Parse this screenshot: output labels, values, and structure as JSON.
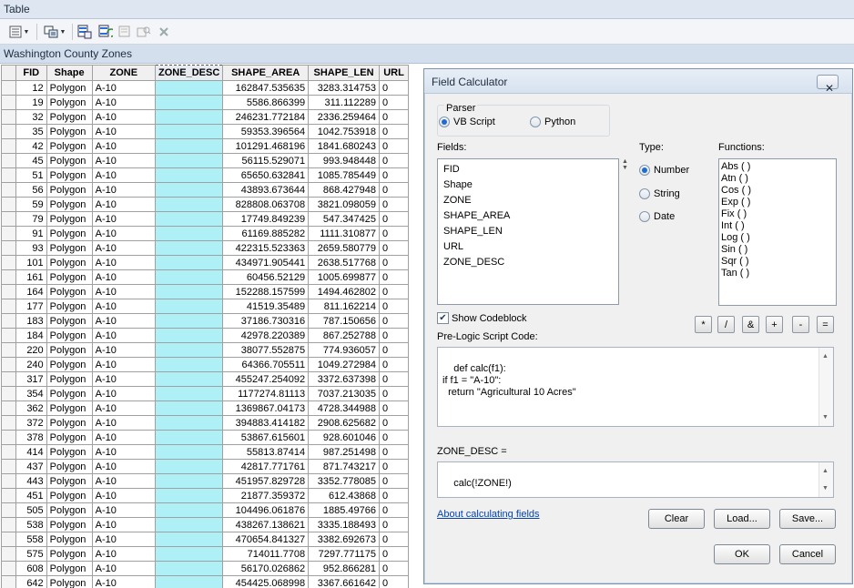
{
  "window": {
    "title": "Table"
  },
  "table_title": "Washington County Zones",
  "columns": [
    "FID",
    "Shape",
    "ZONE",
    "ZONE_DESC",
    "SHAPE_AREA",
    "SHAPE_LEN",
    "URL"
  ],
  "rows": [
    [
      "12",
      "Polygon",
      "A-10",
      "",
      "162847.535635",
      "3283.314753",
      "0"
    ],
    [
      "19",
      "Polygon",
      "A-10",
      "",
      "5586.866399",
      "311.112289",
      "0"
    ],
    [
      "32",
      "Polygon",
      "A-10",
      "",
      "246231.772184",
      "2336.259464",
      "0"
    ],
    [
      "35",
      "Polygon",
      "A-10",
      "",
      "59353.396564",
      "1042.753918",
      "0"
    ],
    [
      "42",
      "Polygon",
      "A-10",
      "",
      "101291.468196",
      "1841.680243",
      "0"
    ],
    [
      "45",
      "Polygon",
      "A-10",
      "",
      "56115.529071",
      "993.948448",
      "0"
    ],
    [
      "51",
      "Polygon",
      "A-10",
      "",
      "65650.632841",
      "1085.785449",
      "0"
    ],
    [
      "56",
      "Polygon",
      "A-10",
      "",
      "43893.673644",
      "868.427948",
      "0"
    ],
    [
      "59",
      "Polygon",
      "A-10",
      "",
      "828808.063708",
      "3821.098059",
      "0"
    ],
    [
      "79",
      "Polygon",
      "A-10",
      "",
      "17749.849239",
      "547.347425",
      "0"
    ],
    [
      "91",
      "Polygon",
      "A-10",
      "",
      "61169.885282",
      "1111.310877",
      "0"
    ],
    [
      "93",
      "Polygon",
      "A-10",
      "",
      "422315.523363",
      "2659.580779",
      "0"
    ],
    [
      "101",
      "Polygon",
      "A-10",
      "",
      "434971.905441",
      "2638.517768",
      "0"
    ],
    [
      "161",
      "Polygon",
      "A-10",
      "",
      "60456.52129",
      "1005.699877",
      "0"
    ],
    [
      "164",
      "Polygon",
      "A-10",
      "",
      "152288.157599",
      "1494.462802",
      "0"
    ],
    [
      "177",
      "Polygon",
      "A-10",
      "",
      "41519.35489",
      "811.162214",
      "0"
    ],
    [
      "183",
      "Polygon",
      "A-10",
      "",
      "37186.730316",
      "787.150656",
      "0"
    ],
    [
      "184",
      "Polygon",
      "A-10",
      "",
      "42978.220389",
      "867.252788",
      "0"
    ],
    [
      "220",
      "Polygon",
      "A-10",
      "",
      "38077.552875",
      "774.936057",
      "0"
    ],
    [
      "240",
      "Polygon",
      "A-10",
      "",
      "64366.705511",
      "1049.272984",
      "0"
    ],
    [
      "317",
      "Polygon",
      "A-10",
      "",
      "455247.254092",
      "3372.637398",
      "0"
    ],
    [
      "354",
      "Polygon",
      "A-10",
      "",
      "1177274.81113",
      "7037.213035",
      "0"
    ],
    [
      "362",
      "Polygon",
      "A-10",
      "",
      "1369867.04173",
      "4728.344988",
      "0"
    ],
    [
      "372",
      "Polygon",
      "A-10",
      "",
      "394883.414182",
      "2908.625682",
      "0"
    ],
    [
      "378",
      "Polygon",
      "A-10",
      "",
      "53867.615601",
      "928.601046",
      "0"
    ],
    [
      "414",
      "Polygon",
      "A-10",
      "",
      "55813.87414",
      "987.251498",
      "0"
    ],
    [
      "437",
      "Polygon",
      "A-10",
      "",
      "42817.771761",
      "871.743217",
      "0"
    ],
    [
      "443",
      "Polygon",
      "A-10",
      "",
      "451957.829728",
      "3352.778085",
      "0"
    ],
    [
      "451",
      "Polygon",
      "A-10",
      "",
      "21877.359372",
      "612.43868",
      "0"
    ],
    [
      "505",
      "Polygon",
      "A-10",
      "",
      "104496.061876",
      "1885.49766",
      "0"
    ],
    [
      "538",
      "Polygon",
      "A-10",
      "",
      "438267.138621",
      "3335.188493",
      "0"
    ],
    [
      "558",
      "Polygon",
      "A-10",
      "",
      "470654.841327",
      "3382.692673",
      "0"
    ],
    [
      "575",
      "Polygon",
      "A-10",
      "",
      "714011.7708",
      "7297.771175",
      "0"
    ],
    [
      "608",
      "Polygon",
      "A-10",
      "",
      "56170.026862",
      "952.866281",
      "0"
    ],
    [
      "642",
      "Polygon",
      "A-10",
      "",
      "454425.068998",
      "3367.661642",
      "0"
    ]
  ],
  "dialog": {
    "title": "Field Calculator",
    "close_glyph": "✕",
    "parser_label": "Parser",
    "parser_options": [
      "VB Script",
      "Python"
    ],
    "parser_selected": "VB Script",
    "fields_label": "Fields:",
    "fields": [
      "FID",
      "Shape",
      "ZONE",
      "SHAPE_AREA",
      "SHAPE_LEN",
      "URL",
      "ZONE_DESC"
    ],
    "type_label": "Type:",
    "types": [
      "Number",
      "String",
      "Date"
    ],
    "type_selected": "Number",
    "functions_label": "Functions:",
    "functions": [
      "Abs ( )",
      "Atn ( )",
      "Cos ( )",
      "Exp ( )",
      "Fix ( )",
      "Int ( )",
      "Log ( )",
      "Sin ( )",
      "Sqr ( )",
      "Tan ( )"
    ],
    "show_codeblock_label": "Show Codeblock",
    "show_codeblock_checked": true,
    "operators": [
      "*",
      "/",
      "&",
      "+",
      "-",
      "="
    ],
    "prelogic_label": "Pre-Logic Script Code:",
    "prelogic_code": "def calc(f1):\nif f1 = \"A-10\":\n  return \"Agricultural 10 Acres\"",
    "expression_label": "ZONE_DESC =",
    "expression": "calc(!ZONE!)",
    "about_link": "About calculating fields",
    "clear_label": "Clear",
    "load_label": "Load...",
    "save_label": "Save...",
    "ok_label": "OK",
    "cancel_label": "Cancel"
  },
  "colors": {
    "zone_desc_highlight": "#aef0f5",
    "link": "#0645ad",
    "radio_accent": "#1f6bd0"
  },
  "icons": [
    "table-options-icon",
    "related-tables-icon",
    "select-by-attributes-icon",
    "switch-selection-icon",
    "clear-selection-icon",
    "zoom-to-selected-icon",
    "delete-selected-icon"
  ]
}
